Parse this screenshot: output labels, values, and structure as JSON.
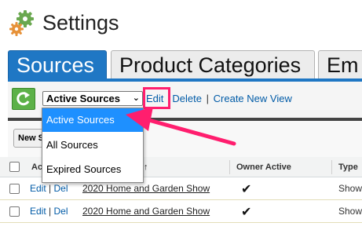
{
  "header": {
    "title": "Settings",
    "icon": "gears-icon"
  },
  "tabs": [
    {
      "label": "Sources",
      "active": true
    },
    {
      "label": "Product Categories",
      "active": false
    },
    {
      "label": "Em",
      "active": false
    }
  ],
  "toolbar": {
    "refresh_icon": "refresh-icon",
    "view_select_value": "Active Sources",
    "links": {
      "edit": "Edit",
      "delete": "Delete",
      "create": "Create New View"
    },
    "separator": "|"
  },
  "dropdown": {
    "options": [
      "Active Sources",
      "All Sources",
      "Expired Sources"
    ],
    "selected_index": 0
  },
  "row2": {
    "new_button": "New S"
  },
  "table": {
    "columns": {
      "action": "Ac",
      "name": "↑",
      "owner_active": "Owner Active",
      "type": "Type"
    },
    "rows": [
      {
        "edit": "Edit",
        "del": "Del",
        "name": "2020 Home and Garden Show",
        "owner_active": "✔",
        "type": "Show"
      },
      {
        "edit": "Edit",
        "del": "Del",
        "name": "2020 Home and Garden Show",
        "owner_active": "✔",
        "type": "Show"
      }
    ]
  },
  "colors": {
    "accent": "#1f77c4",
    "highlight": "#ff1e6e",
    "selected": "#1e90ff",
    "link": "#015ba7"
  }
}
